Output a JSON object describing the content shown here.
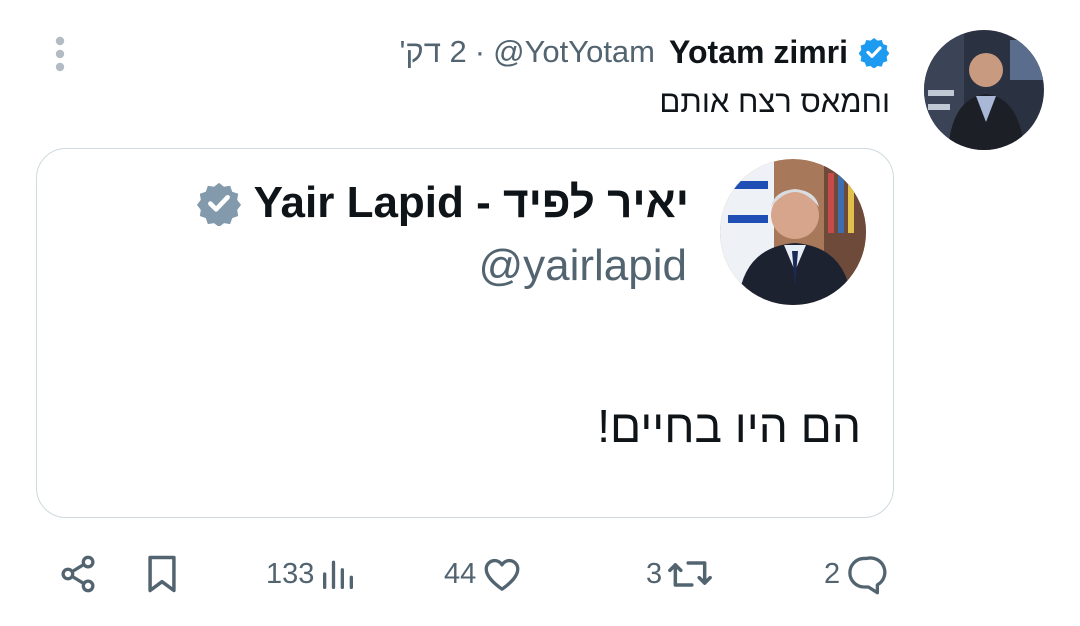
{
  "tweet": {
    "author_name": "Yotam zimri",
    "handle": "@YotYotam",
    "separator": "·",
    "time": "2 דק'",
    "text": "וחמאס רצח אותם",
    "avatar": "author-avatar-photo",
    "more_icon": "more-vertical-icon"
  },
  "quote": {
    "name": "יאיר לפיד - Yair Lapid",
    "handle": "@yairlapid",
    "text": "הם היו בחיים!",
    "avatar": "quoted-avatar-photo"
  },
  "actions": {
    "replies": "2",
    "retweets": "3",
    "likes": "44",
    "views": "133"
  },
  "icons": {
    "share": "share-icon",
    "bookmark": "bookmark-icon",
    "views": "views-chart-icon",
    "like": "heart-icon",
    "retweet": "retweet-icon",
    "reply": "reply-icon",
    "verified_blue": "verified-badge-icon",
    "verified_gray": "verified-badge-gray-icon"
  },
  "colors": {
    "text": "#0f1419",
    "secondary": "#536471",
    "verified_blue": "#1d9bf0",
    "verified_gray": "#829aab",
    "border": "#cfd9de"
  }
}
